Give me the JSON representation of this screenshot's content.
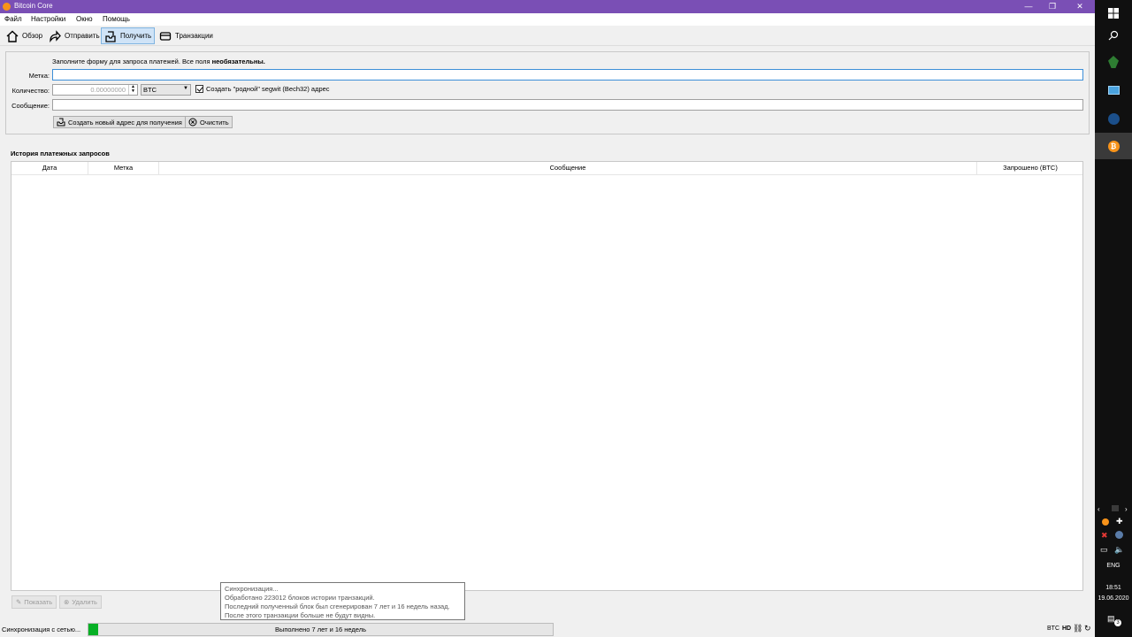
{
  "window": {
    "title": "Bitcoin Core"
  },
  "menu": [
    "Файл",
    "Настройки",
    "Окно",
    "Помощь"
  ],
  "toolbar": {
    "overview": "Обзор",
    "send": "Отправить",
    "receive": "Получить",
    "transactions": "Транзакции"
  },
  "form": {
    "intro": "Заполните форму для запроса платежей. Все поля ",
    "intro_bold": "необязательны.",
    "label_label": "Метка:",
    "label_value": "",
    "amount_label": "Количество:",
    "amount_placeholder": "0.00000000",
    "unit": "BTC",
    "segwit_label": "Создать \"родной\" segwit (Bech32) адрес",
    "segwit_checked": true,
    "message_label": "Сообщение:",
    "message_value": "",
    "create_button": "Создать новый адрес для получения",
    "clear_button": "Очистить"
  },
  "history": {
    "title": "История платежных запросов",
    "columns": [
      "Дата",
      "Метка",
      "Сообщение",
      "Запрошено (BTC)"
    ],
    "rows": [],
    "show_button": "Показать",
    "remove_button": "Удалить"
  },
  "tooltip": {
    "lines": [
      "Синхронизация...",
      "Обработано 223012 блоков истории транзакций.",
      "Последний полученный блок был сгенерирован 7 лет и 16 недель назад.",
      "После этого транзакции больше не будут видны."
    ]
  },
  "status": {
    "sync_label": "Синхронизация с сетью...",
    "progress_text": "Выполнено 7 лет и 16 недель",
    "progress_fraction": 0.02,
    "unit": "BTC",
    "hd": "HD"
  },
  "taskbar": {
    "lang": "ENG",
    "time": "18:51",
    "date": "19.06.2020",
    "notifications": "3"
  }
}
